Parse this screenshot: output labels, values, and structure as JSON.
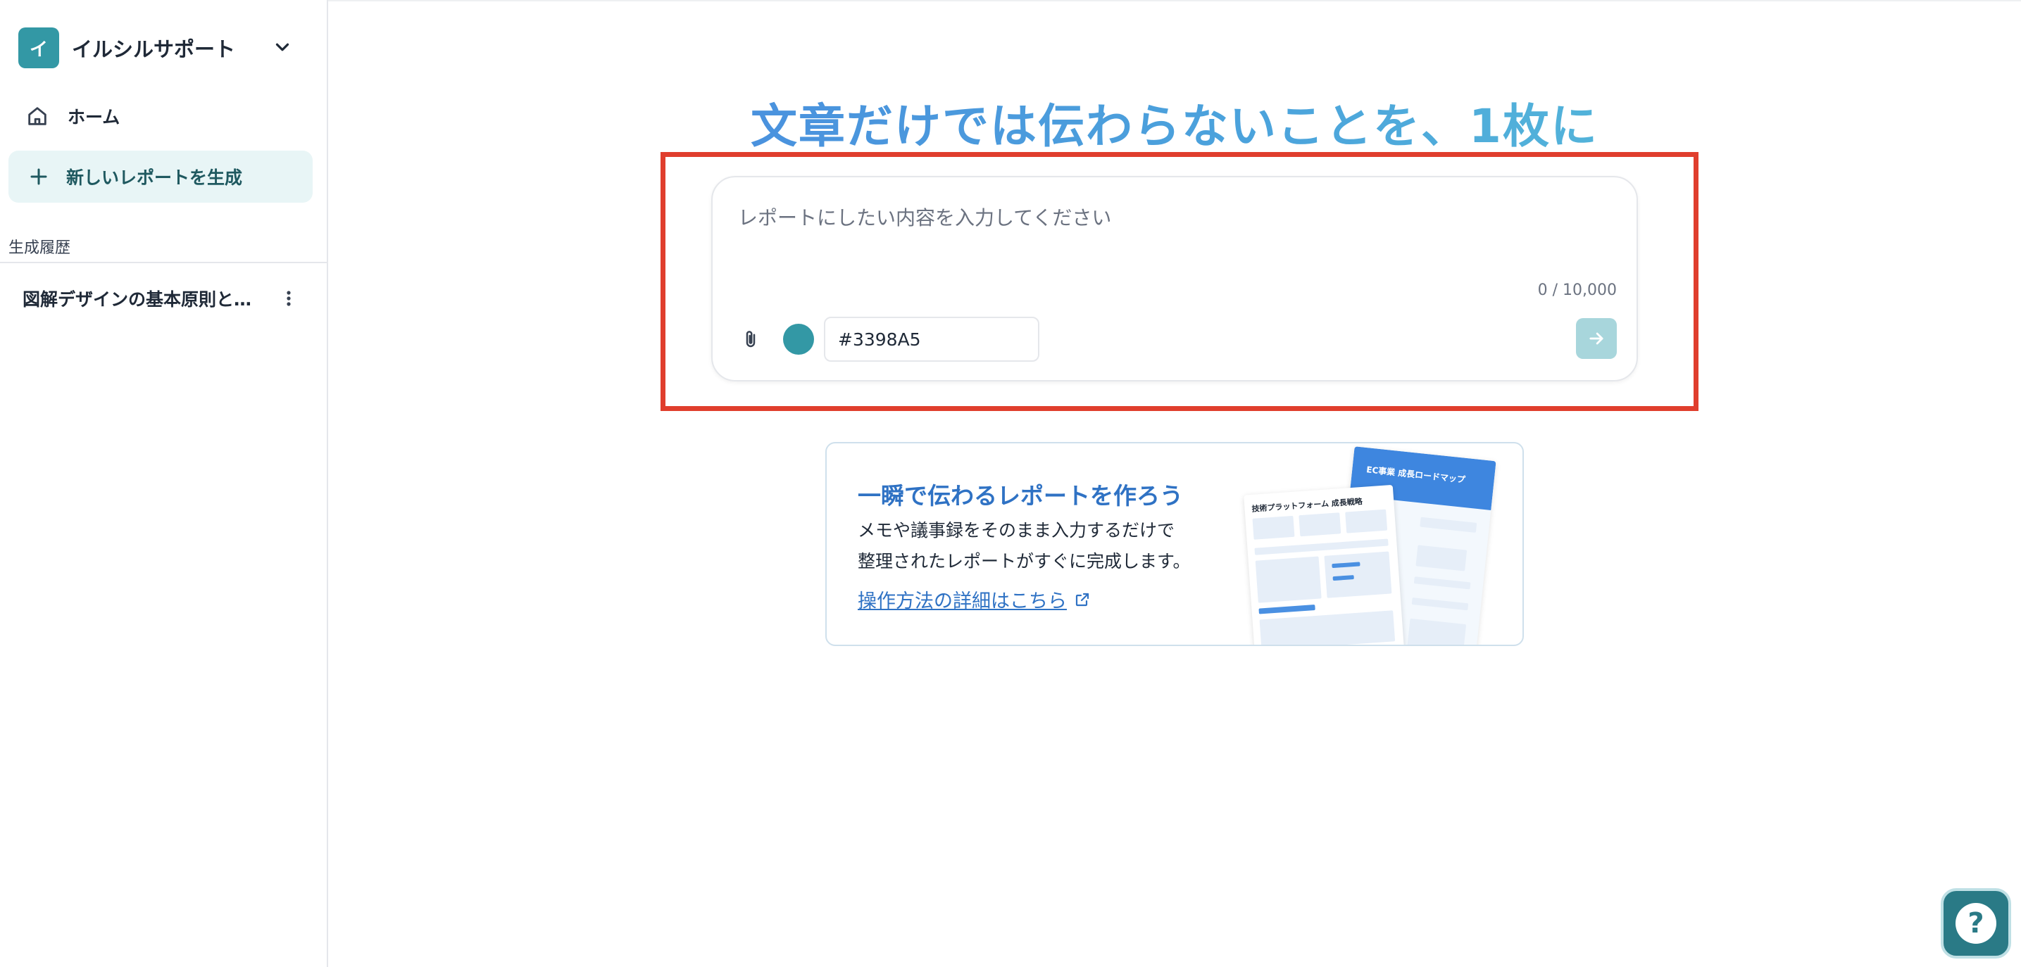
{
  "sidebar": {
    "workspace": {
      "initial": "イ",
      "name": "イルシルサポート"
    },
    "nav": {
      "home_label": "ホーム",
      "new_report_label": "新しいレポートを生成"
    },
    "history_label": "生成履歴",
    "history_items": [
      {
        "label": "図解デザインの基本原則と…"
      }
    ]
  },
  "main": {
    "headline": "文章だけでは伝わらないことを、1枚に",
    "composer": {
      "placeholder": "レポートにしたい内容を入力してください",
      "value": "",
      "char_count": "0 / 10,000",
      "color_value": "#3398A5"
    },
    "promo": {
      "title": "一瞬で伝わるレポートを作ろう",
      "line1": "メモや議事録をそのまま入力するだけで",
      "line2": "整理されたレポートがすぐに完成します。",
      "link": "操作方法の詳細はこちら",
      "thumb_back_title": "EC事業 成長ロードマップ",
      "thumb_front_title": "技術プラットフォーム 成長戦略"
    }
  },
  "help": {
    "glyph": "?"
  },
  "colors": {
    "accent": "#3398A5",
    "highlight": "#e03e2d",
    "link": "#2f72c4"
  }
}
